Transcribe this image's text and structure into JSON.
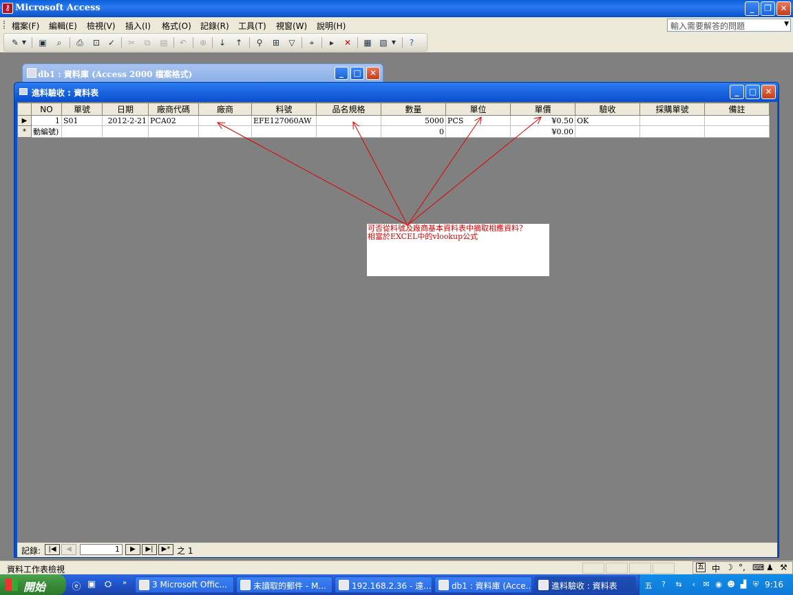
{
  "app": {
    "title": "Microsoft Access"
  },
  "menu": {
    "items": [
      "檔案(F)",
      "編輯(E)",
      "檢視(V)",
      "插入(I)",
      "格式(O)",
      "記錄(R)",
      "工具(T)",
      "視窗(W)",
      "說明(H)"
    ],
    "help_placeholder": "輸入需要解答的問題"
  },
  "db_window": {
    "title": "db1 : 資料庫 (Access 2000 檔案格式)"
  },
  "datasheet": {
    "title": "進料驗收 : 資料表",
    "columns": [
      "NO",
      "單號",
      "日期",
      "廠商代碼",
      "廠商",
      "料號",
      "品名規格",
      "數量",
      "單位",
      "單價",
      "驗收",
      "採購單號",
      "備註"
    ],
    "rows": [
      [
        "1",
        "S01",
        "2012-2-21",
        "PCA02",
        "",
        "EFE127060AW",
        "",
        "5000",
        "PCS",
        "¥0.50",
        "OK",
        "",
        ""
      ]
    ],
    "new_row": [
      "動編號)",
      "",
      "",
      "",
      "",
      "",
      "",
      "0",
      "",
      "¥0.00",
      "",
      "",
      ""
    ],
    "new_row_selector": "*",
    "current_row_selector": "▶"
  },
  "annotation": {
    "line1": "可否從料號及廠商基本資料表中摘取相應資料？",
    "line2": "相當於EXCEL中的vlookup公式"
  },
  "record_nav": {
    "label": "記錄:",
    "current": "1",
    "of_label": "之",
    "total": "1"
  },
  "status": {
    "text": "資料工作表檢視"
  },
  "ime": {
    "label": "中"
  },
  "taskbar": {
    "start_label": "開始",
    "tasks": [
      "3 Microsoft Offic...",
      "未讀取的郵件 - M...",
      "192.168.2.36 - 遠...",
      "db1 : 資料庫 (Acce...",
      "進料驗收 : 資料表"
    ],
    "clock": "9:16"
  },
  "colors": {
    "annotation_text": "#d00000",
    "arrow": "#e00000"
  }
}
